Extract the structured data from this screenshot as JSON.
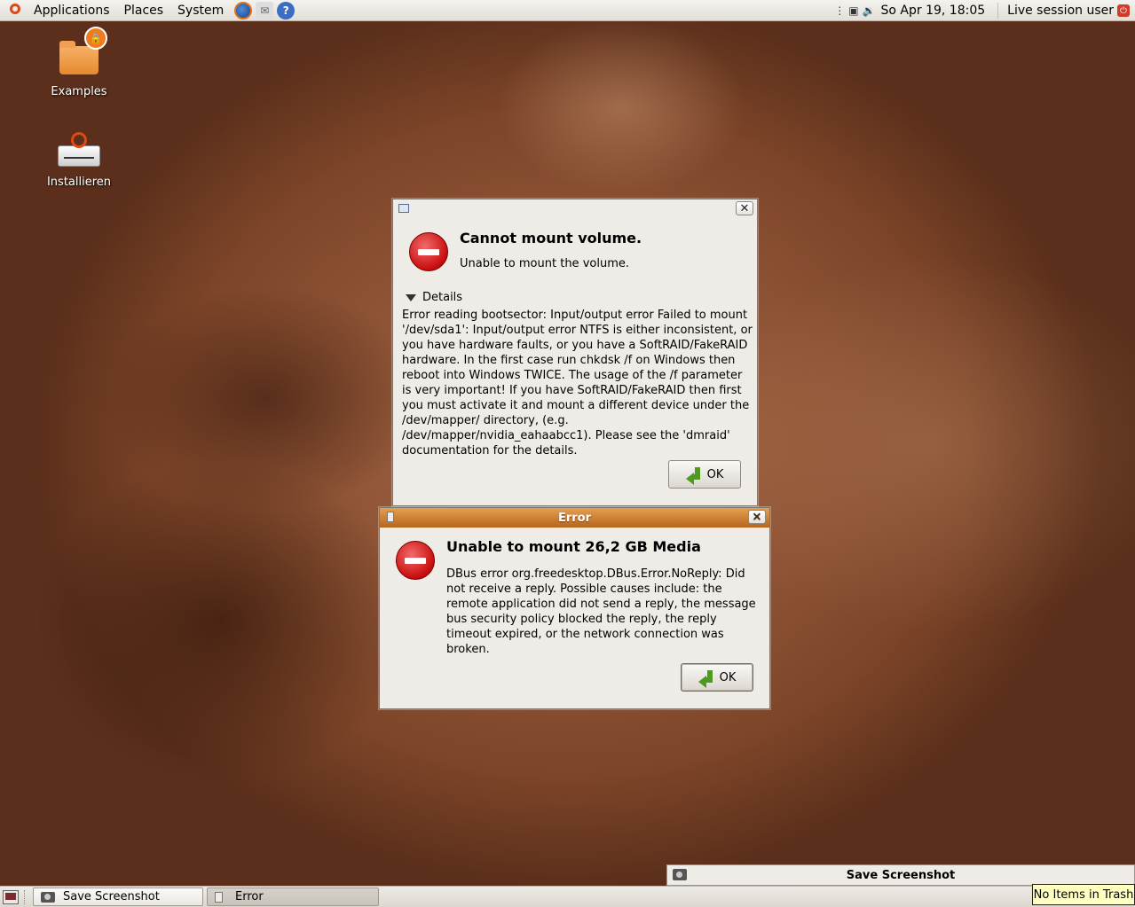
{
  "top_panel": {
    "menus": [
      "Applications",
      "Places",
      "System"
    ],
    "clock": "So Apr 19, 18:05",
    "user": "Live session user"
  },
  "desktop_icons": [
    {
      "label": "Examples"
    },
    {
      "label": "Installieren"
    }
  ],
  "details_dialog": {
    "title": "Cannot mount volume.",
    "subtitle": "Unable to mount the volume.",
    "details_label": "Details",
    "details_text": "Error reading bootsector: Input/output error Failed to mount '/dev/sda1': Input/output error NTFS is either inconsistent, or you have hardware faults, or you have a SoftRAID/FakeRAID hardware. In the first case run chkdsk /f on Windows then reboot into Windows TWICE. The usage of the /f parameter is very important! If you have SoftRAID/FakeRAID then first you must activate it and mount a different device under the /dev/mapper/ directory, (e.g. /dev/mapper/nvidia_eahaabcc1). Please see the 'dmraid' documentation for the details.",
    "ok_label": "OK"
  },
  "error_dialog": {
    "window_title": "Error",
    "title": "Unable to mount 26,2 GB Media",
    "message": "DBus error org.freedesktop.DBus.Error.NoReply: Did not receive a reply. Possible causes include: the remote application did not send a reply, the message bus security policy blocked the reply, the reply timeout expired, or the network connection was broken.",
    "ok_label": "OK"
  },
  "save_screenshot_window": {
    "title": "Save Screenshot"
  },
  "bottom_panel": {
    "tasks": [
      "Save Screenshot",
      "Error"
    ],
    "trash_tooltip": "No Items in Trash"
  }
}
